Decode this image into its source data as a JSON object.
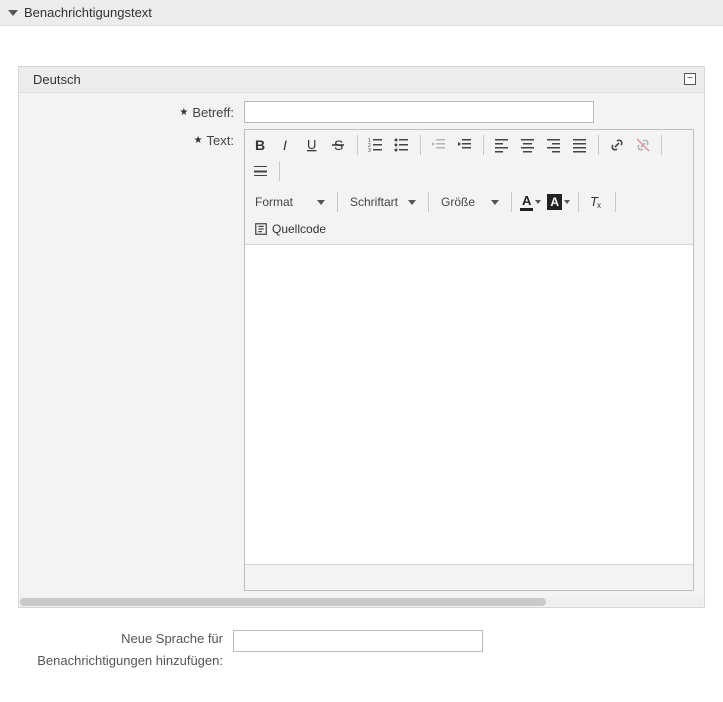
{
  "section": {
    "title": "Benachrichtigungstext"
  },
  "langPanel": {
    "title": "Deutsch"
  },
  "fields": {
    "subject": {
      "label": "Betreff:",
      "value": ""
    },
    "text": {
      "label": "Text:"
    }
  },
  "toolbar": {
    "format": "Format",
    "font": "Schriftart",
    "size": "Größe",
    "source": "Quellcode",
    "textcolor_glyph": "A",
    "bgcolor_glyph": "A"
  },
  "addLang": {
    "label": "Neue Sprache für Benachrichtigungen hinzufügen:",
    "value": ""
  }
}
